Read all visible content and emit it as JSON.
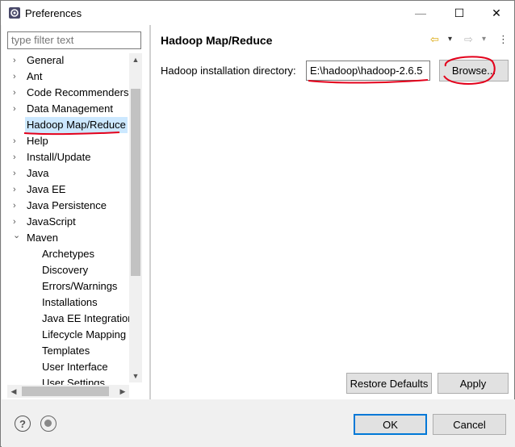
{
  "window": {
    "title": "Preferences",
    "controls": {
      "minimize": "—",
      "maximize": "☐",
      "close": "✕"
    }
  },
  "left": {
    "filter_placeholder": "type filter text",
    "tree": [
      {
        "label": "General",
        "arrow": "›",
        "level": 0
      },
      {
        "label": "Ant",
        "arrow": "›",
        "level": 0
      },
      {
        "label": "Code Recommenders",
        "arrow": "›",
        "level": 0
      },
      {
        "label": "Data Management",
        "arrow": "›",
        "level": 0
      },
      {
        "label": "Hadoop Map/Reduce",
        "arrow": "",
        "level": 0,
        "selected": true
      },
      {
        "label": "Help",
        "arrow": "›",
        "level": 0
      },
      {
        "label": "Install/Update",
        "arrow": "›",
        "level": 0
      },
      {
        "label": "Java",
        "arrow": "›",
        "level": 0
      },
      {
        "label": "Java EE",
        "arrow": "›",
        "level": 0
      },
      {
        "label": "Java Persistence",
        "arrow": "›",
        "level": 0
      },
      {
        "label": "JavaScript",
        "arrow": "›",
        "level": 0
      },
      {
        "label": "Maven",
        "arrow": "⌄",
        "level": 0
      },
      {
        "label": "Archetypes",
        "arrow": "",
        "level": 1
      },
      {
        "label": "Discovery",
        "arrow": "",
        "level": 1
      },
      {
        "label": "Errors/Warnings",
        "arrow": "",
        "level": 1
      },
      {
        "label": "Installations",
        "arrow": "",
        "level": 1
      },
      {
        "label": "Java EE Integration",
        "arrow": "",
        "level": 1
      },
      {
        "label": "Lifecycle Mapping",
        "arrow": "",
        "level": 1
      },
      {
        "label": "Templates",
        "arrow": "",
        "level": 1
      },
      {
        "label": "User Interface",
        "arrow": "",
        "level": 1
      },
      {
        "label": "User Settings",
        "arrow": "",
        "level": 1
      }
    ]
  },
  "main": {
    "title": "Hadoop Map/Reduce",
    "nav": {
      "back": "⇦",
      "back_menu": "▾",
      "forward": "⇨",
      "forward_menu": "▾",
      "view_menu": "⋮"
    },
    "install_dir_label": "Hadoop installation directory:",
    "install_dir_value": "E:\\hadoop\\hadoop-2.6.5",
    "browse_label": "Browse...",
    "restore_defaults_label": "Restore Defaults",
    "apply_label": "Apply"
  },
  "footer": {
    "help_glyph": "?",
    "ok_label": "OK",
    "cancel_label": "Cancel"
  },
  "colors": {
    "selection": "#cce8ff",
    "annotation_red": "#e3001b",
    "default_button_border": "#0078d7"
  }
}
